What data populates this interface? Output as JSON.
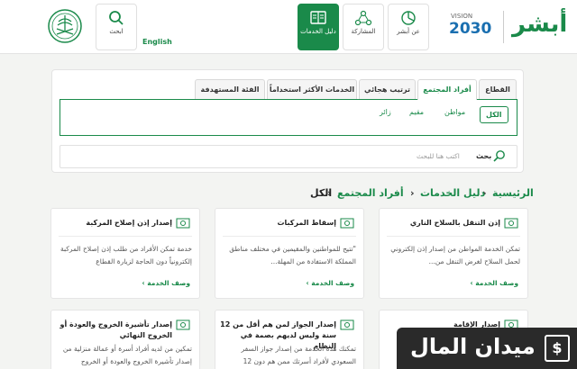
{
  "header": {
    "search_label": "ابحث",
    "lang_label": "English",
    "services_guide_label": "دليل الخدمات",
    "participation_label": "المشاركة",
    "about_label": "عن أبشر",
    "vision_label": "VISION",
    "vision_year": "2030",
    "logo_label": "أبشر",
    "colors": {
      "brand": "#1a8a4a"
    }
  },
  "tabs": [
    {
      "label": "القطاع",
      "active": false
    },
    {
      "label": "أفراد المجتمع",
      "active": true
    },
    {
      "label": "ترتيب هجائي",
      "active": false
    },
    {
      "label": "الخدمات الأكثر استخداماً",
      "active": false
    },
    {
      "label": "الفئة المستهدفة",
      "active": false
    }
  ],
  "filters": {
    "all": "الكل",
    "citizen": "مواطن",
    "resident": "مقيم",
    "visitor": "زائر"
  },
  "search": {
    "label": "بحث",
    "placeholder": "اكتب هنا للبحث"
  },
  "breadcrumb": {
    "home": "الرئيسية",
    "guide": "دليل الخدمات",
    "community": "أفراد المجتمع",
    "current": "الكل"
  },
  "cards": [
    {
      "title": "إذن التنقل بالسلاح الناري",
      "desc": "تمكن الخدمة المواطن من إصدار إذن إلكتروني لحمل السلاح لغرض التنقل من...",
      "more": "وصف الخدمة ›"
    },
    {
      "title": "إسقاط المركبات",
      "desc": "\"تتيح للمواطنين والمقيمين في مختلف مناطق المملكة الاستفادة من المهلة...",
      "more": "وصف الخدمة ›"
    },
    {
      "title": "إصدار إذن إصلاح المركبة",
      "desc": "خدمة تمكن الأفراد من طلب إذن إصلاح المركبة إلكترونياً دون الحاجة لزيارة القطاع",
      "more": "وصف الخدمة ›"
    },
    {
      "title": "إصدار الإقامة",
      "desc": "",
      "more": ""
    },
    {
      "title": "إصدار الجواز لمن هم أقل من 12 سنة وليس لديهم بصمة في النظام",
      "desc": "تمكنك هذه الخدمة من إصدار جواز السفر السعودي لأفراد أسرتك ممن هم دون 12",
      "more": ""
    },
    {
      "title": "إصدار تأشيرة الخروج والعودة أو الخروج النهائي",
      "desc": "تمكين من لديه أفراد أسرة أو عمالة منزلية من إصدار تأشيرة الخروج والعودة أو الخروج",
      "more": ""
    }
  ],
  "watermark": {
    "text": "ميدان المال",
    "icon": "$"
  }
}
